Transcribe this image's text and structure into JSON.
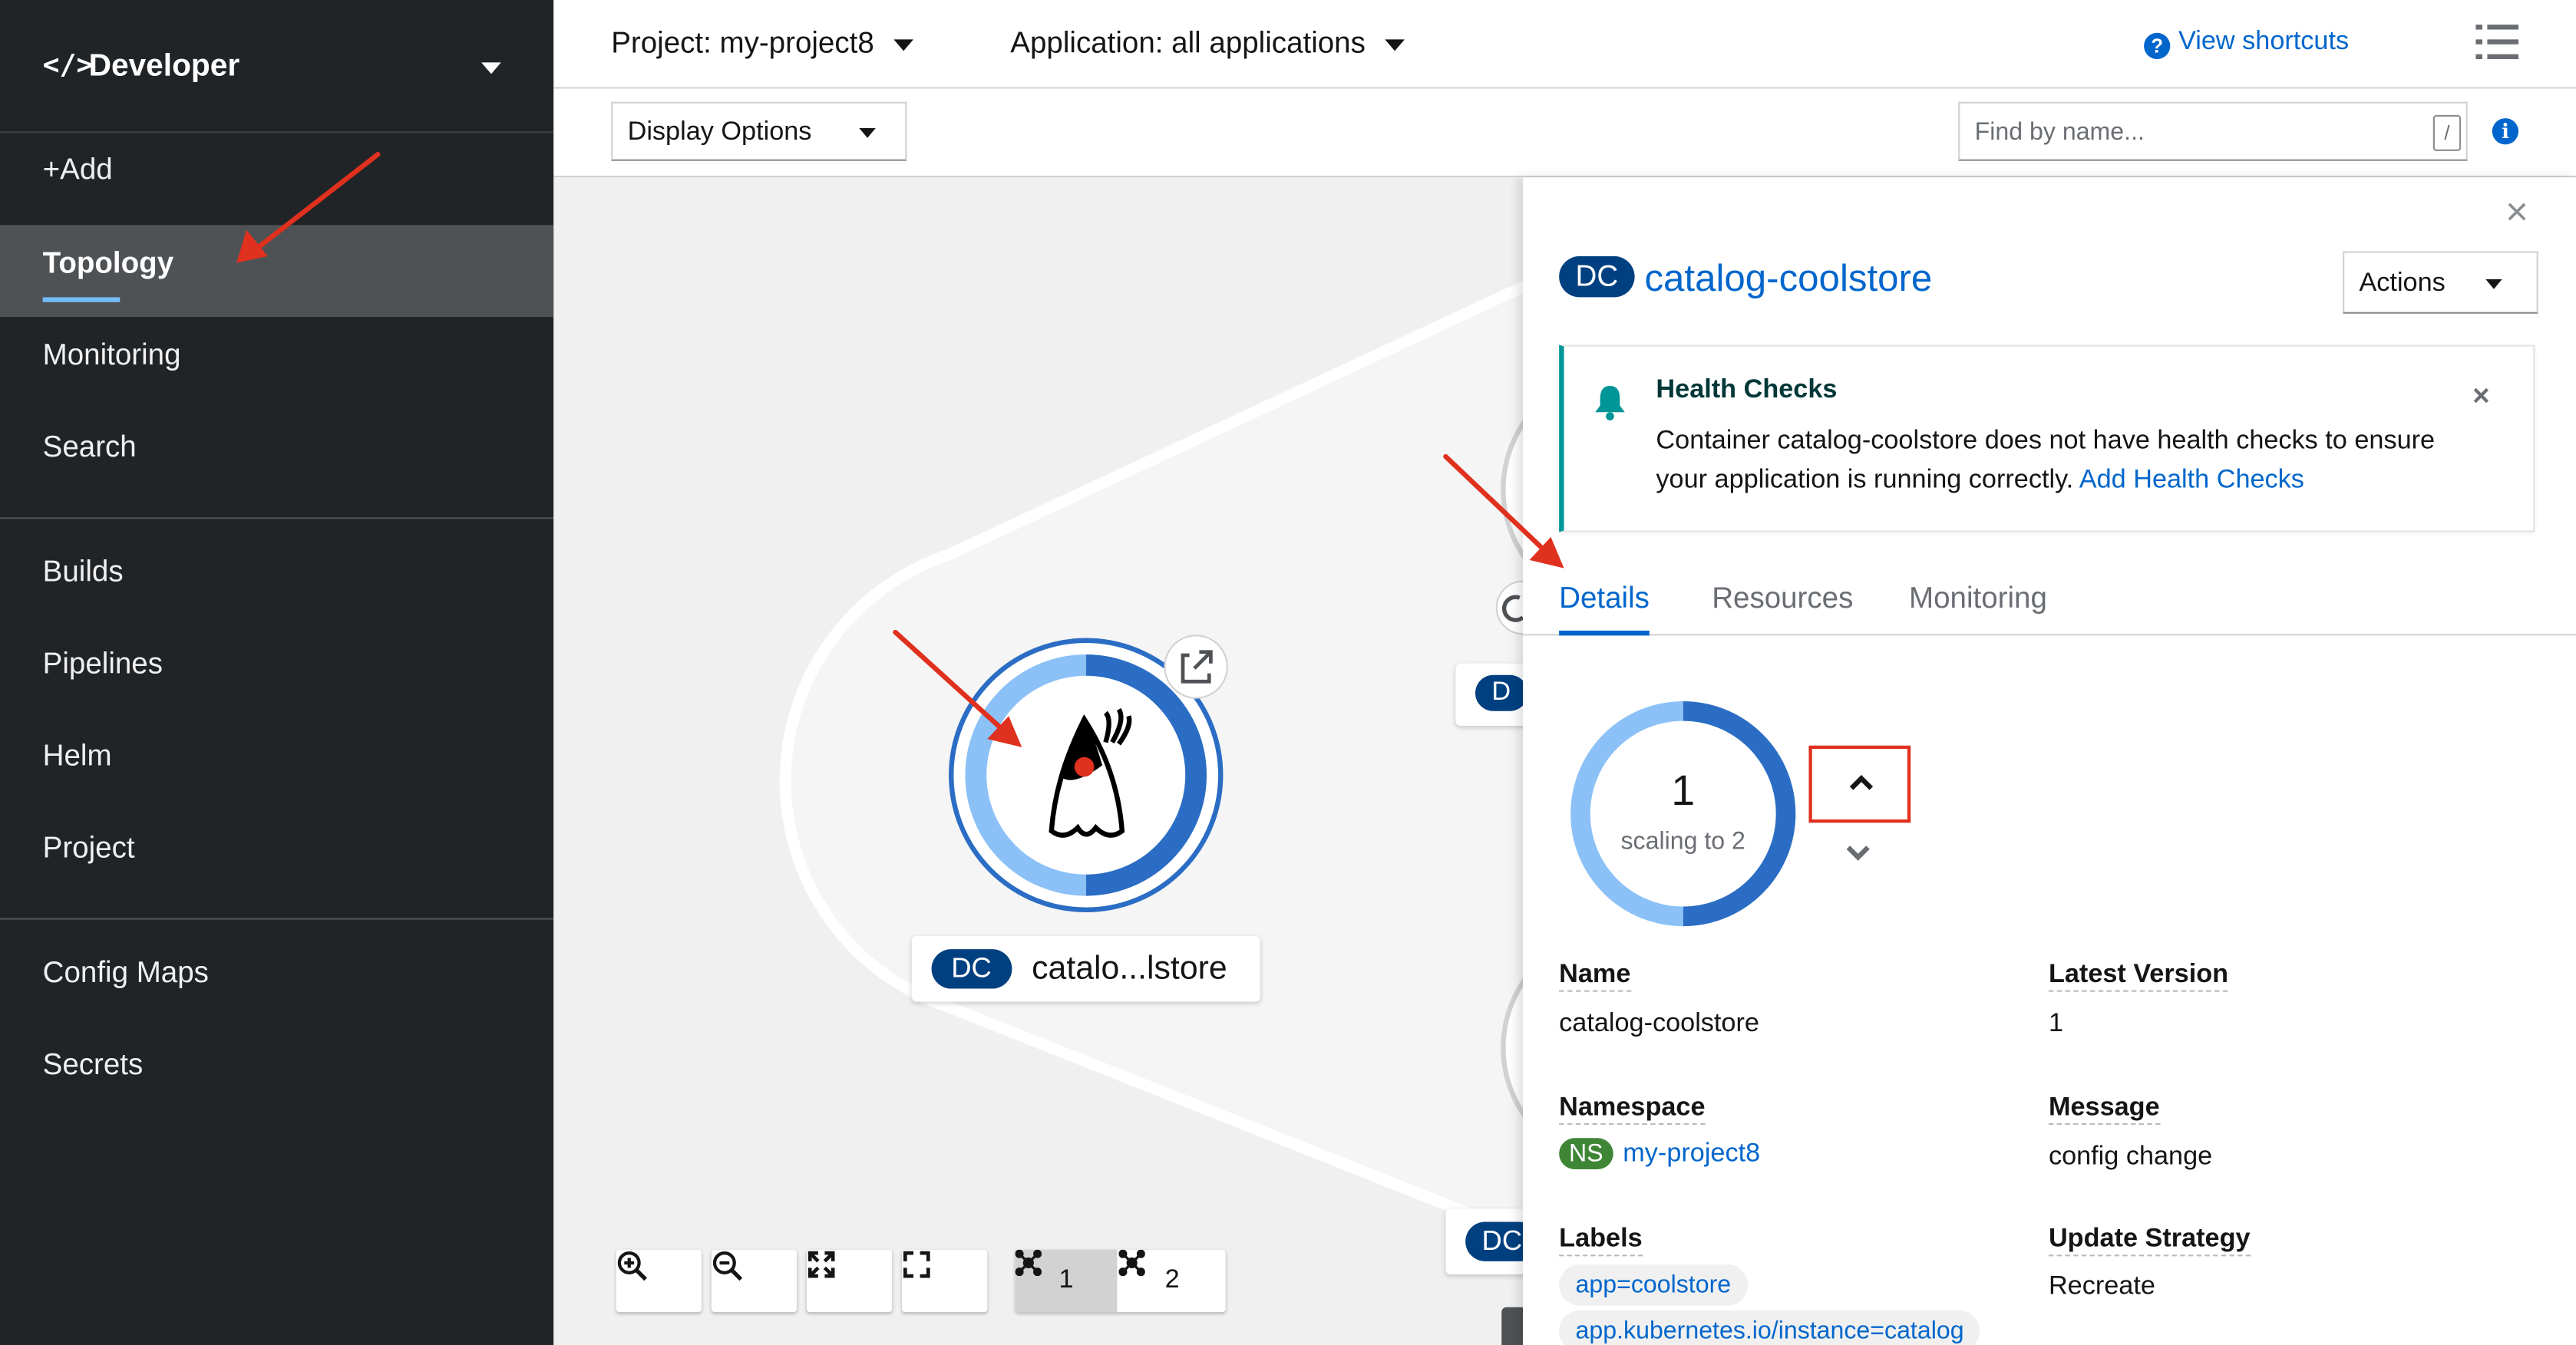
{
  "perspective": {
    "code_icon": "</>",
    "title": "Developer"
  },
  "nav": {
    "add": "+Add",
    "topology": "Topology",
    "monitoring": "Monitoring",
    "search": "Search",
    "builds": "Builds",
    "pipelines": "Pipelines",
    "helm": "Helm",
    "project": "Project",
    "config_maps": "Config Maps",
    "secrets": "Secrets"
  },
  "header": {
    "project": "Project: my-project8",
    "application": "Application: all applications",
    "view_shortcuts": "View shortcuts",
    "help_icon": "?"
  },
  "toolbar": {
    "display_options": "Display Options",
    "find_placeholder": "Find by name...",
    "slash_hint": "/",
    "info_icon": "i"
  },
  "canvas": {
    "node_badge": "DC",
    "node_name": "catalo...lstore",
    "partial_badge_1": "D",
    "partial_badge_2": "DC",
    "layout_1": "1",
    "layout_2": "2",
    "colors": {
      "pod_light": "#8bc1f7",
      "pod_dark": "#2b6dc4"
    }
  },
  "panel": {
    "close": "×",
    "badge": "DC",
    "name": "catalog-coolstore",
    "actions": "Actions",
    "alert": {
      "title": "Health Checks",
      "text": "Container catalog-coolstore does not have health checks to ensure your application is running correctly.",
      "link": "Add Health Checks",
      "close": "×"
    },
    "tabs": {
      "details": "Details",
      "resources": "Resources",
      "monitoring": "Monitoring"
    },
    "pods": {
      "count": "1",
      "scaling": "scaling to 2"
    },
    "details": {
      "name_label": "Name",
      "name_value": "catalog-coolstore",
      "latest_version_label": "Latest Version",
      "latest_version_value": "1",
      "namespace_label": "Namespace",
      "namespace_badge": "NS",
      "namespace_value": "my-project8",
      "message_label": "Message",
      "message_value": "config change",
      "labels_label": "Labels",
      "labels": [
        "app=coolstore",
        "app.kubernetes.io/instance=catalog"
      ],
      "update_strategy_label": "Update Strategy",
      "update_strategy_value": "Recreate"
    }
  }
}
